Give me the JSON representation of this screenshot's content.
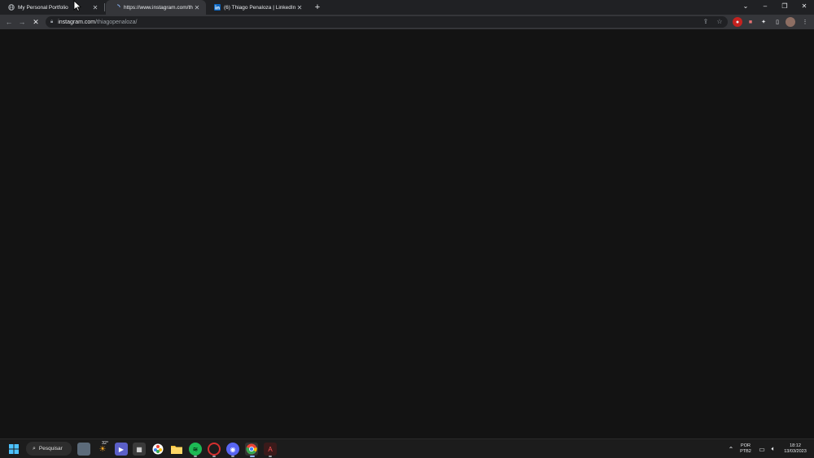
{
  "browser": {
    "tabs": [
      {
        "title": "My Personal Portfolio",
        "favicon": "globe-icon",
        "active": false
      },
      {
        "title": "https://www.instagram.com/thia",
        "favicon": "loading-icon",
        "active": true
      },
      {
        "title": "(6) Thiago Penaloza | LinkedIn",
        "favicon": "linkedin-icon",
        "active": false
      }
    ],
    "close_glyph": "✕",
    "new_tab_glyph": "+",
    "address": {
      "host": "instagram.com",
      "path": "/thiagopenaloza/"
    }
  },
  "taskbar": {
    "search_label": "Pesquisar",
    "weather": "32°",
    "language": "POR",
    "layout": "PTB2",
    "time": "18:12",
    "date": "13/03/2023"
  },
  "colors": {
    "tab_bar": "#202124",
    "toolbar": "#35363a",
    "content": "#131313",
    "taskbar": "#1c1c1c"
  }
}
